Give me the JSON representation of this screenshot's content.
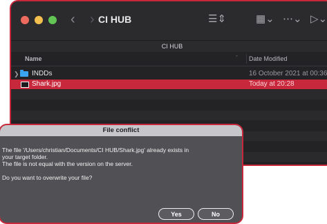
{
  "finder": {
    "title": "CI HUB",
    "path_label": "CI HUB",
    "columns": {
      "name": "Name",
      "date": "Date Modified"
    },
    "rows": [
      {
        "name": "INDDs",
        "date": "16 October 2021 at 00:36",
        "kind": "folder",
        "selected": false
      },
      {
        "name": "Shark.jpg",
        "date": "Today at 20:28",
        "kind": "file",
        "selected": true
      }
    ],
    "icons": {
      "back": "chevron-left-icon",
      "forward": "chevron-right-icon",
      "list_view": "list-view-icon",
      "grid_view": "grid-view-icon",
      "more": "more-options-icon",
      "tag": "tag-icon"
    }
  },
  "dialog": {
    "title": "File conflict",
    "lines": [
      "The file '/Users/christian/Documents/CI HUB/Shark.jpg' already exists in",
      "your target folder.",
      "The file is not equal with the version on the server.",
      "",
      "Do you want to overwrite your file?"
    ],
    "buttons": {
      "yes": "Yes",
      "no": "No"
    }
  },
  "colors": {
    "accent": "#c8283c",
    "finder_bg": "#232326",
    "dialog_bg": "#515155",
    "folder": "#3aa4f0"
  }
}
